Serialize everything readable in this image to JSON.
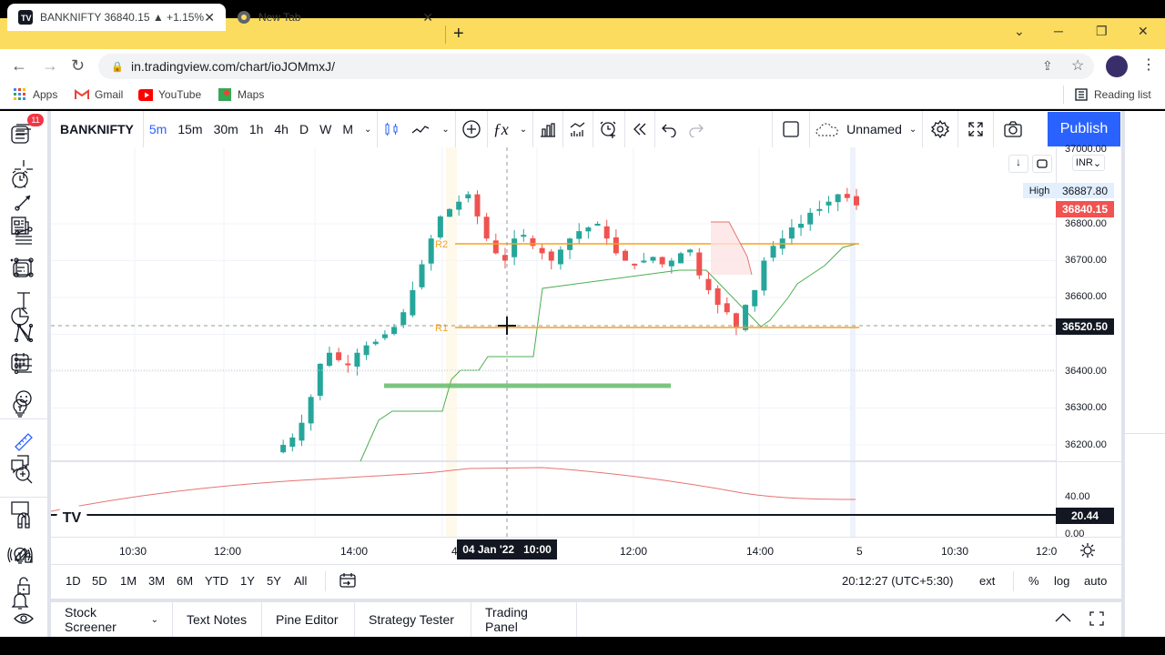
{
  "browser": {
    "tabs": [
      {
        "title": "BANKNIFTY 36840.15 ▲ +1.15%",
        "icon": "tradingview-logo-icon",
        "active": true
      },
      {
        "title": "New Tab",
        "icon": "chrome-icon",
        "active": false
      }
    ],
    "url": "in.tradingview.com/chart/ioJOMmxJ/",
    "bookmarks": [
      {
        "label": "Apps",
        "icon": "apps-grid-icon"
      },
      {
        "label": "Gmail",
        "icon": "gmail-icon"
      },
      {
        "label": "YouTube",
        "icon": "youtube-icon"
      },
      {
        "label": "Maps",
        "icon": "maps-icon"
      }
    ],
    "reading_list": "Reading list"
  },
  "tradingview": {
    "menu_badge": "11",
    "symbol": "BANKNIFTY",
    "intervals": [
      "5m",
      "15m",
      "30m",
      "1h",
      "4h",
      "D",
      "W",
      "M"
    ],
    "active_interval": "5m",
    "layout_name": "Unnamed",
    "publish_label": "Publish",
    "currency": "INR",
    "high_label": "High",
    "high_value": "36887.80",
    "last_price": "36840.15",
    "crosshair_price": "36520.50",
    "indicator_value": "20.44",
    "price_ticks": [
      "37000.00",
      "36800.00",
      "36700.00",
      "36600.00",
      "36400.00",
      "36300.00",
      "36200.00"
    ],
    "indicator_ticks": [
      "40.00",
      "0.00"
    ],
    "time_ticks": [
      "10:30",
      "12:00",
      "14:00",
      "4",
      "12:00",
      "14:00",
      "5",
      "10:30",
      "12:0"
    ],
    "crosshair_time": "04 Jan '22   10:00",
    "level_labels": [
      "R2",
      "R1"
    ],
    "ranges": [
      "1D",
      "5D",
      "1M",
      "3M",
      "6M",
      "YTD",
      "1Y",
      "5Y",
      "All"
    ],
    "clock": "20:12:27 (UTC+5:30)",
    "ext_label": "ext",
    "pct_label": "%",
    "log_label": "log",
    "auto_label": "auto",
    "bottom_tabs": [
      "Stock Screener",
      "Text Notes",
      "Pine Editor",
      "Strategy Tester",
      "Trading Panel"
    ],
    "colors": {
      "up": "#26a69a",
      "down": "#ef5350",
      "accent": "#2962ff",
      "level": "#f7a21b",
      "support": "#4caf50",
      "indicator": "#e57373"
    }
  }
}
